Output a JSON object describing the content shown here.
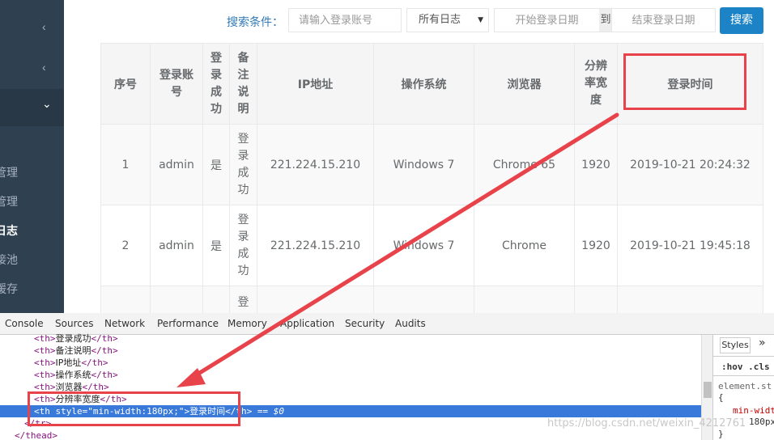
{
  "sidebar": {
    "chevrons": [
      "‹",
      "‹",
      "⌄"
    ],
    "items": [
      {
        "label": "管理",
        "active": false
      },
      {
        "label": "管理",
        "active": false
      },
      {
        "label": "日志",
        "active": true
      },
      {
        "label": "接池",
        "active": false
      },
      {
        "label": "缓存",
        "active": false
      }
    ]
  },
  "search": {
    "label": "搜索条件：",
    "account_placeholder": "请输入登录账号",
    "log_select": "所有日志",
    "start_placeholder": "开始登录日期",
    "to_label": "到",
    "end_placeholder": "结束登录日期",
    "search_button": "搜索"
  },
  "table": {
    "headers": [
      "序号",
      "登录账号",
      "登录成功",
      "备注说明",
      "IP地址",
      "操作系统",
      "浏览器",
      "分辨率宽度",
      "登录时间"
    ],
    "rows": [
      [
        "1",
        "admin",
        "是",
        "登录成功",
        "221.224.15.210",
        "Windows 7",
        "Chrome 65",
        "1920",
        "2019-10-21 20:24:32"
      ],
      [
        "2",
        "admin",
        "是",
        "登录成功",
        "221.224.15.210",
        "Windows 7",
        "Chrome",
        "1920",
        "2019-10-21 19:45:18"
      ],
      [
        "",
        "",
        "",
        "登",
        "",
        "",
        "",
        "",
        ""
      ]
    ]
  },
  "devtools": {
    "tabs": [
      "Console",
      "Sources",
      "Network",
      "Performance",
      "Memory",
      "Application",
      "Security",
      "Audits"
    ],
    "lines": [
      {
        "open": "<th>",
        "text": "登录成功",
        "close": "</th>"
      },
      {
        "open": "<th>",
        "text": "备注说明",
        "close": "</th>"
      },
      {
        "open": "<th>",
        "text": "IP地址",
        "close": "</th>"
      },
      {
        "open": "<th>",
        "text": "操作系统",
        "close": "</th>"
      },
      {
        "open": "<th>",
        "text": "浏览器",
        "close": "</th>"
      },
      {
        "open": "<th>",
        "text": "分辨率宽度",
        "close": "</th>"
      }
    ],
    "selected": {
      "tag_open": "<th",
      "attr": "style",
      "value": "\"min-width:180px;\"",
      "gt": ">",
      "text": "登录时间",
      "close": "</th>",
      "suffix": "== $0"
    },
    "tr_close": "</tr>",
    "thead_close": "</thead>",
    "styles_tab": "Styles",
    "styles_more": "»",
    "filter": ":hov  .cls",
    "element_style": "element.st",
    "brace_open": "{",
    "prop": "min-widt",
    "prop_val": "180px",
    "brace_close": "}"
  },
  "watermark": "https://blog.csdn.net/weixin_4212761",
  "colors": {
    "sidebar": "#2f4050",
    "button": "#1c84c6",
    "highlight": "#e8424a",
    "selected_line": "#3879d9"
  }
}
